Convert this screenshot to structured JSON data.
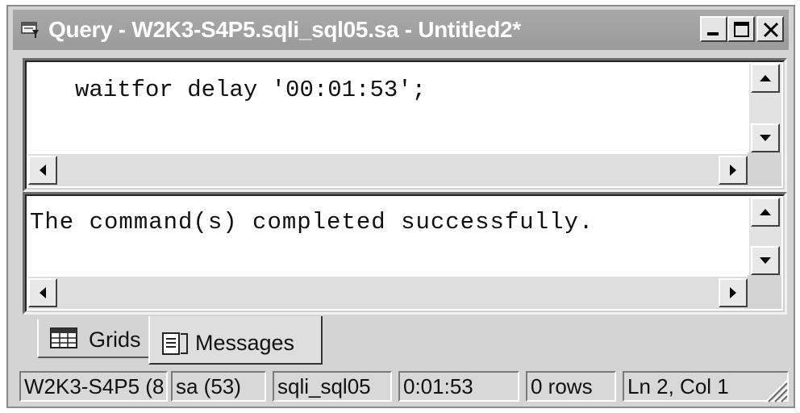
{
  "window": {
    "title": "Query - W2K3-S4P5.sqli_sql05.sa - Untitled2*",
    "title_icon": "query-window-icon",
    "buttons": {
      "minimize": "minimize-icon",
      "maximize": "maximize-icon",
      "close": "close-icon"
    }
  },
  "editor": {
    "text": "waitfor delay '00:01:53';"
  },
  "results": {
    "text": "The command(s) completed successfully."
  },
  "tabs": [
    {
      "label": "Grids",
      "icon": "grid-icon",
      "active": false
    },
    {
      "label": "Messages",
      "icon": "messages-icon",
      "active": true
    }
  ],
  "status": {
    "server": "W2K3-S4P5 (8",
    "user": "sa (53)",
    "database": "sqli_sql05",
    "elapsed": "0:01:53",
    "rows": "0 rows",
    "position": "Ln 2, Col 1"
  }
}
